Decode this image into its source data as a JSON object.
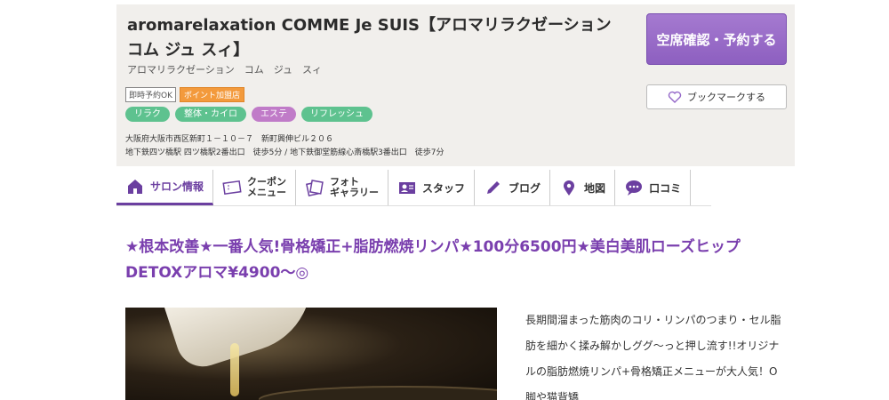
{
  "salon": {
    "name": "aromarelaxation COMME Je SUIS【アロマリラクゼーション コム ジュ スィ】",
    "kana": "アロマリラクゼーション　コム　ジュ　スィ",
    "badges": [
      "即時予約OK",
      "ポイント加盟店"
    ],
    "tags": [
      {
        "label": "リラク",
        "color": "#5ec28f"
      },
      {
        "label": "整体・カイロ",
        "color": "#5ec28f"
      },
      {
        "label": "エステ",
        "color": "#c07bc8"
      },
      {
        "label": "リフレッシュ",
        "color": "#5ec28f"
      }
    ],
    "address": "大阪府大阪市西区新町１－１０－７　新町興伸ビル２０６",
    "access": "地下鉄四ツ橋駅 四ツ橋駅2番出口　徒歩5分 / 地下鉄御堂筋線心斎橋駅3番出口　徒歩7分"
  },
  "actions": {
    "reserve_label": "空席確認・予約する",
    "bookmark_label": "ブックマークする"
  },
  "nav": {
    "items": [
      {
        "label": "サロン情報",
        "icon": "home-icon"
      },
      {
        "label_line1": "クーポン",
        "label_line2": "メニュー",
        "icon": "coupon-icon"
      },
      {
        "label_line1": "フォト",
        "label_line2": "ギャラリー",
        "icon": "photo-icon"
      },
      {
        "label": "スタッフ",
        "icon": "staff-icon"
      },
      {
        "label": "ブログ",
        "icon": "pencil-icon"
      },
      {
        "label": "地図",
        "icon": "map-pin-icon"
      },
      {
        "label": "口コミ",
        "icon": "speech-bubble-icon"
      }
    ]
  },
  "main": {
    "headline": "★根本改善★一番人気!骨格矯正+脂肪燃焼リンパ★100分6500円★美白美肌ローズヒップDETOXアロマ¥4900～◎",
    "description": "長期間溜まった筋肉のコリ・リンパのつまり・セル脂肪を細かく揉み解かしググ～っと押し流す!!オリジナルの脂肪燃焼リンパ+骨格矯正メニューが大人気！O脚や猫背矯"
  },
  "colors": {
    "accent": "#7a3fae",
    "reserve_button": "#9467c8",
    "tag_green": "#5ec28f",
    "tag_purple": "#c07bc8",
    "badge_orange": "#f39a3c"
  }
}
